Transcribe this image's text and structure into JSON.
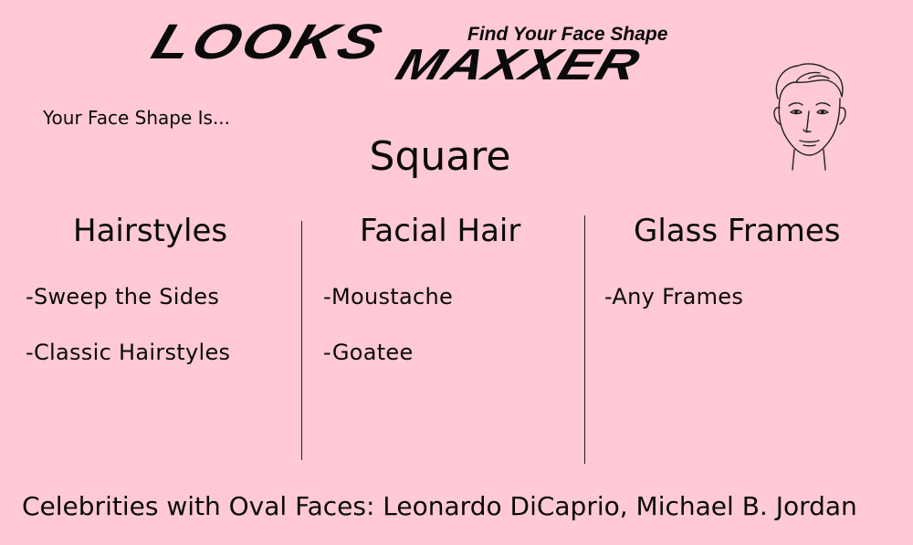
{
  "logo": {
    "looks": "LOOKS",
    "maxxer": "MAXXER",
    "tagline": "Find Your Face Shape"
  },
  "intro_text": "Your Face Shape Is...",
  "face_shape": "Square",
  "columns": {
    "hairstyles": {
      "heading": "Hairstyles",
      "items": [
        "-Sweep the Sides",
        "-Classic Hairstyles"
      ]
    },
    "facial_hair": {
      "heading": "Facial Hair",
      "items": [
        "-Moustache",
        "-Goatee"
      ]
    },
    "glass_frames": {
      "heading": "Glass Frames",
      "items": [
        "-Any Frames"
      ]
    }
  },
  "footer": "Celebrities with Oval Faces: Leonardo DiCaprio, Michael B. Jordan",
  "colors": {
    "background": "#ffc9d6",
    "text": "#0a0a0a"
  },
  "icon": "male-face-illustration"
}
